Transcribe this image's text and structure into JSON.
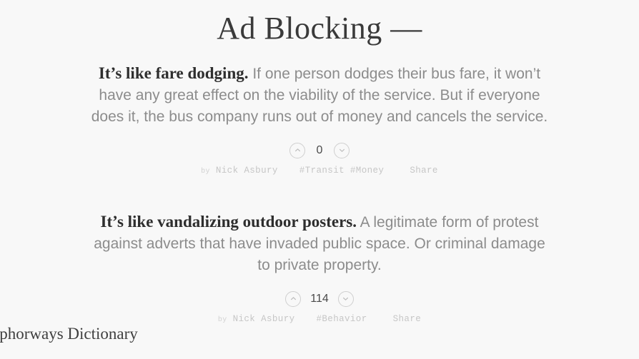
{
  "header": {
    "title": "Ad Blocking —"
  },
  "entries": [
    {
      "lead_in": "It’s like fare dodging.",
      "body": " If one person dodges their bus fare, it won’t have any great effect on the viability of the service. But if everyone does it, the bus company runs out of money and cancels the service.",
      "score": "0",
      "upvote_icon": "chevron-up-icon",
      "downvote_icon": "chevron-down-icon",
      "by_label": "by",
      "author": "Nick Asbury",
      "tags": "#Transit #Money",
      "share_label": "Share"
    },
    {
      "lead_in": "It’s like vandalizing outdoor posters.",
      "body": " A legitimate form of protest against adverts that have invaded public space. Or criminal damage to private property.",
      "score": "114",
      "upvote_icon": "chevron-up-icon",
      "downvote_icon": "chevron-down-icon",
      "by_label": "by",
      "author": "Nick Asbury",
      "tags": "#Behavior",
      "share_label": "Share"
    }
  ],
  "footer": {
    "site_name": "Metaphorways Dictionary"
  },
  "colors": {
    "background": "#f8f8f8",
    "title": "#3a3a3a",
    "body_text": "#8c8c8c",
    "lead_in": "#2e2e2e",
    "meta_text": "#c6c6c6",
    "vote_border": "#cfcfcf",
    "score_text": "#4a4a4a"
  }
}
